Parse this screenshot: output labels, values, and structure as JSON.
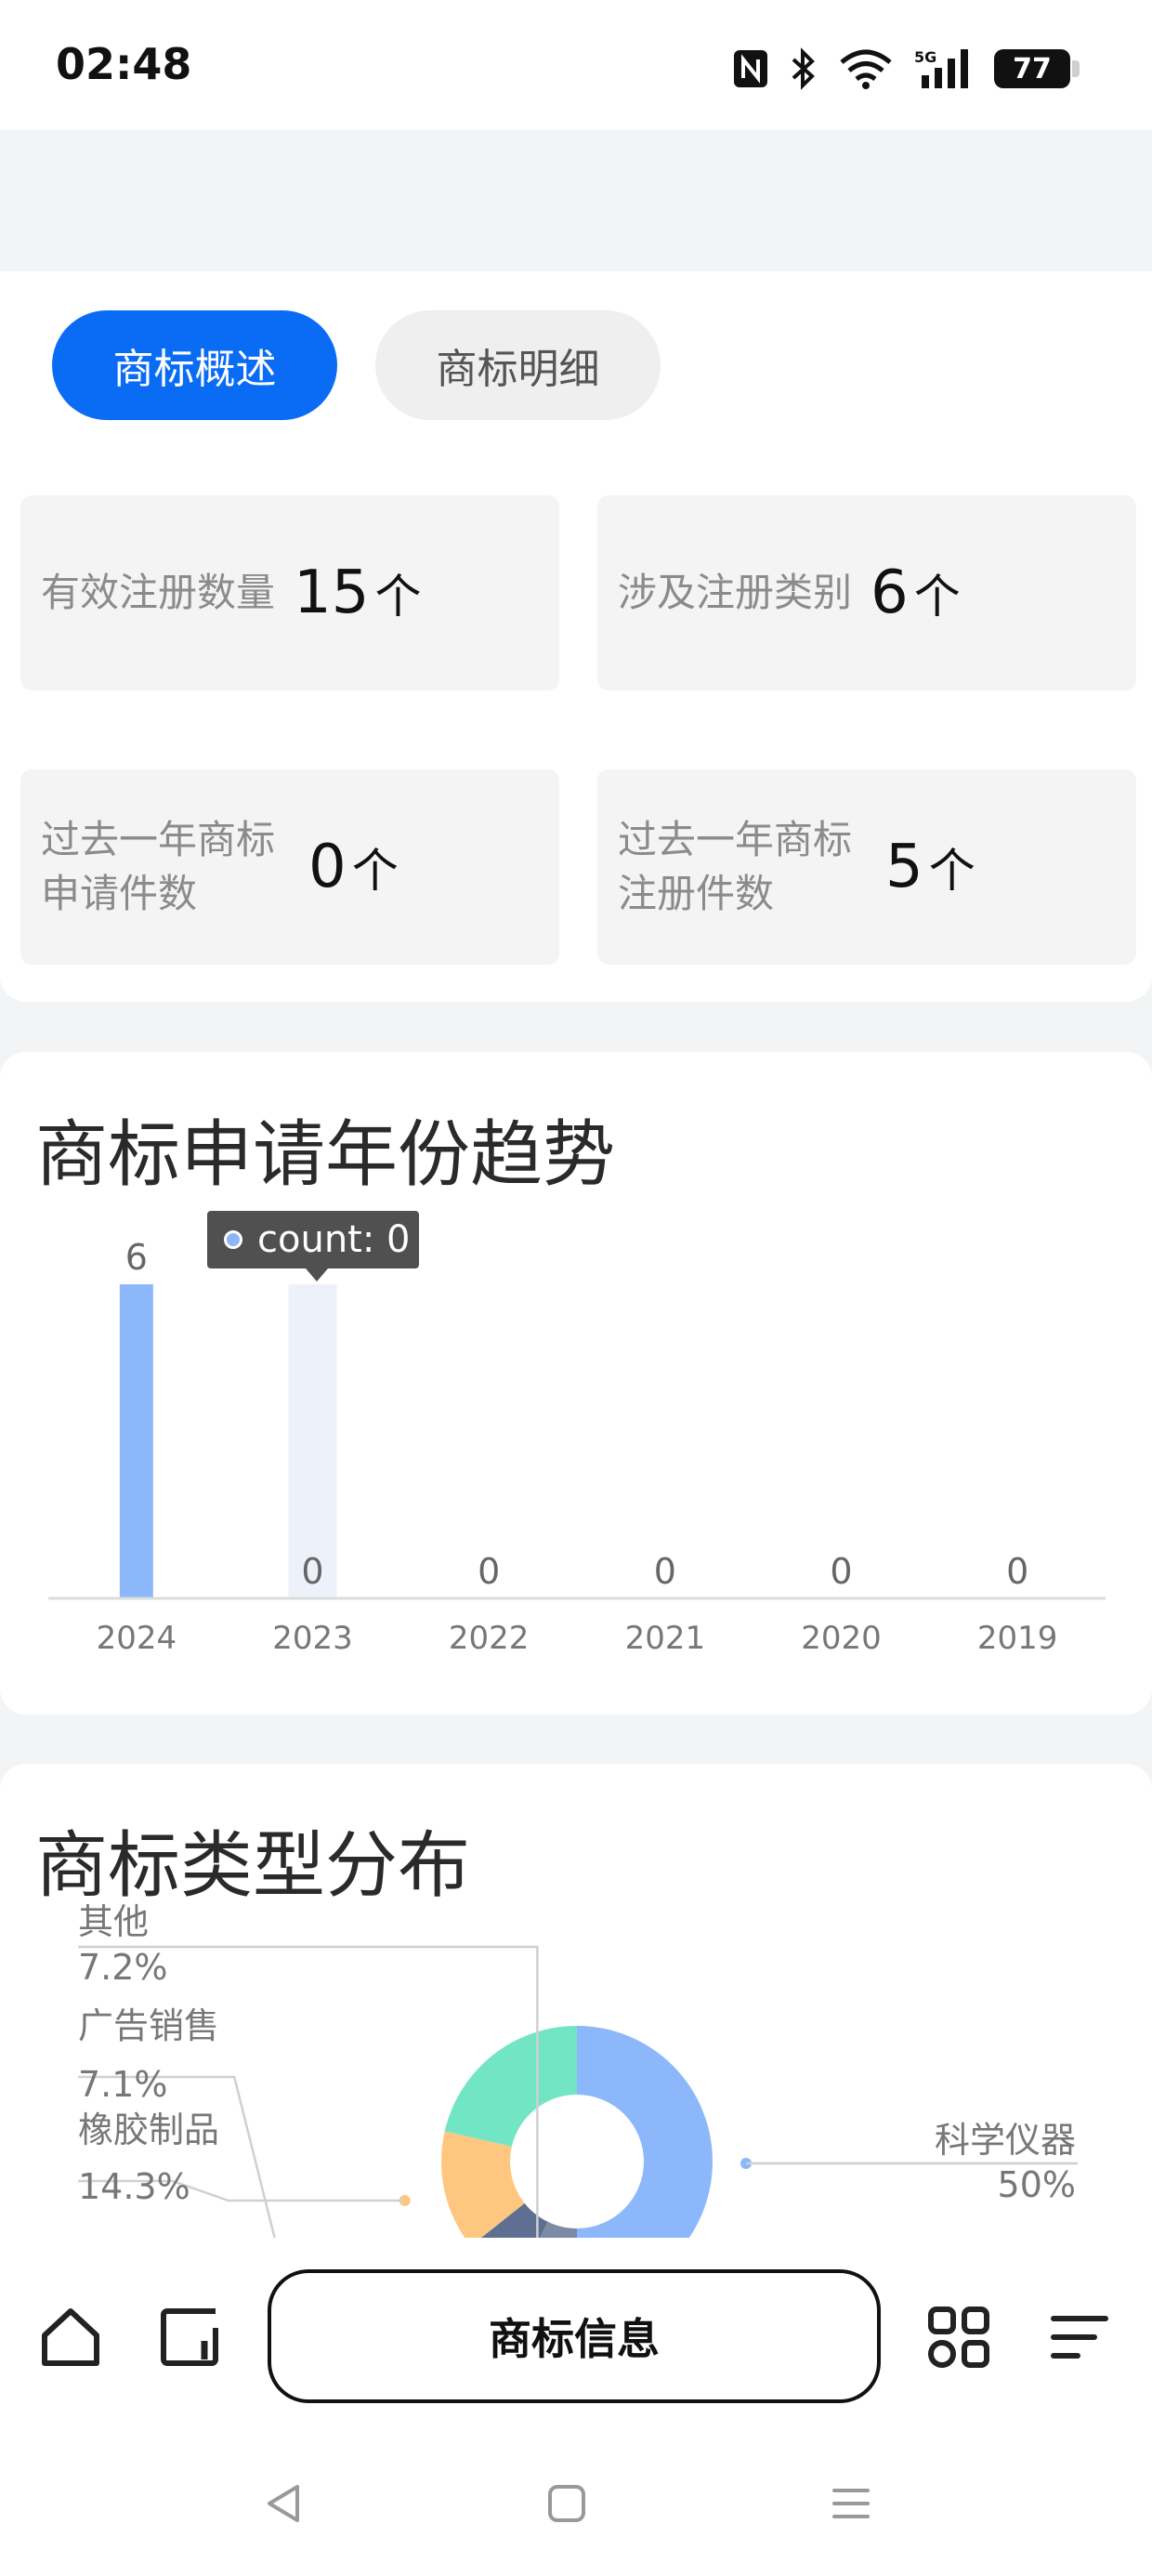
{
  "status_bar": {
    "time": "02:48",
    "icons": [
      "nfc-icon",
      "bluetooth-icon",
      "wifi-icon",
      "signal-5g-icon"
    ],
    "battery": "77"
  },
  "tabs": [
    {
      "label": "商标概述",
      "active": true
    },
    {
      "label": "商标明细",
      "active": false
    }
  ],
  "stats": [
    {
      "label": "有效注册数量",
      "value": "15",
      "unit": "个"
    },
    {
      "label": "涉及注册类别",
      "value": "6",
      "unit": "个"
    },
    {
      "label": "过去一年商标申请件数",
      "value": "0",
      "unit": "个"
    },
    {
      "label": "过去一年商标注册件数",
      "value": "5",
      "unit": "个"
    }
  ],
  "trend": {
    "title": "商标申请年份趋势",
    "tooltip": "count: 0"
  },
  "type_dist": {
    "title": "商标类型分布"
  },
  "chart_data": [
    {
      "type": "bar",
      "title": "商标申请年份趋势",
      "categories": [
        "2024",
        "2023",
        "2022",
        "2021",
        "2020",
        "2019"
      ],
      "values": [
        6,
        0,
        0,
        0,
        0,
        0
      ],
      "ylim": [
        0,
        6
      ],
      "grid": false,
      "highlighted": "2023",
      "colors": {
        "bar": "#8cb8fb",
        "highlight_band": "#edf1fa"
      }
    },
    {
      "type": "pie",
      "title": "商标类型分布",
      "slices": [
        {
          "label": "科学仪器",
          "value": 50,
          "percent": "50%",
          "color": "#8cb8fb"
        },
        {
          "label": "其他",
          "value": 7.2,
          "percent": "7.2%",
          "color": "#7d8aa6"
        },
        {
          "label": "广告销售",
          "value": 7.1,
          "percent": "7.1%",
          "color": "#5f6f91"
        },
        {
          "label": "橡胶制品",
          "value": 14.3,
          "percent": "14.3%",
          "color": "#fdc77f"
        },
        {
          "label": "",
          "value": 21.4,
          "percent": "",
          "color": "#72e6c4"
        }
      ]
    }
  ],
  "bottom_nav": {
    "center_label": "商标信息",
    "icons": [
      "home-icon",
      "recent-icon",
      "apps-icon",
      "menu-icon"
    ]
  },
  "system_nav": [
    "back-icon",
    "home-square-icon",
    "recents-icon"
  ]
}
